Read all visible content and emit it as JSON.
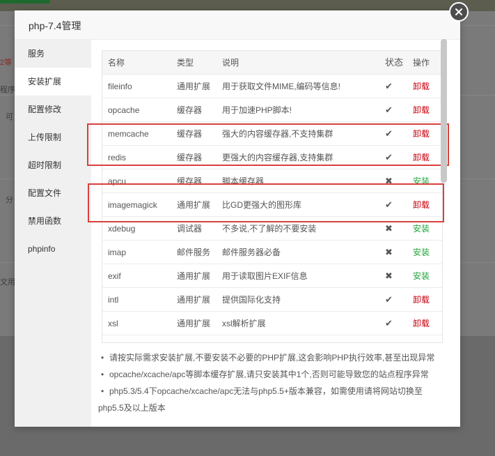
{
  "background": {
    "fragments": [
      "2等",
      "程序,",
      "可",
      "分",
      "文用户"
    ]
  },
  "modal": {
    "title": "php-7.4管理"
  },
  "sidebar": {
    "items": [
      {
        "label": "服务"
      },
      {
        "label": "安装扩展"
      },
      {
        "label": "配置修改"
      },
      {
        "label": "上传限制"
      },
      {
        "label": "超时限制"
      },
      {
        "label": "配置文件"
      },
      {
        "label": "禁用函数"
      },
      {
        "label": "phpinfo"
      }
    ],
    "active_index": 1
  },
  "table": {
    "headers": {
      "name": "名称",
      "type": "类型",
      "desc": "说明",
      "status": "状态",
      "action": "操作"
    },
    "rows": [
      {
        "name": "fileinfo",
        "type": "通用扩展",
        "desc": "用于获取文件MIME,编码等信息!",
        "status": "✔",
        "action": "卸载"
      },
      {
        "name": "opcache",
        "type": "缓存器",
        "desc": "用于加速PHP脚本!",
        "status": "✔",
        "action": "卸载"
      },
      {
        "name": "memcache",
        "type": "缓存器",
        "desc": "强大的内容缓存器,不支持集群",
        "status": "✔",
        "action": "卸载"
      },
      {
        "name": "redis",
        "type": "缓存器",
        "desc": "更强大的内容缓存器,支持集群",
        "status": "✔",
        "action": "卸载"
      },
      {
        "name": "apcu",
        "type": "缓存器",
        "desc": "脚本缓存器",
        "status": "✖",
        "action": "安装"
      },
      {
        "name": "imagemagick",
        "type": "通用扩展",
        "desc": "比GD更强大的图形库",
        "status": "✔",
        "action": "卸载"
      },
      {
        "name": "xdebug",
        "type": "调试器",
        "desc": "不多说,不了解的不要安装",
        "status": "✖",
        "action": "安装"
      },
      {
        "name": "imap",
        "type": "邮件服务",
        "desc": "邮件服务器必备",
        "status": "✖",
        "action": "安装"
      },
      {
        "name": "exif",
        "type": "通用扩展",
        "desc": "用于读取图片EXIF信息",
        "status": "✖",
        "action": "安装"
      },
      {
        "name": "intl",
        "type": "通用扩展",
        "desc": "提供国际化支持",
        "status": "✔",
        "action": "卸载"
      },
      {
        "name": "xsl",
        "type": "通用扩展",
        "desc": "xsl解析扩展",
        "status": "✔",
        "action": "卸载"
      }
    ]
  },
  "tips": [
    "请按实际需求安装扩展,不要安装不必要的PHP扩展,这会影响PHP执行效率,甚至出现异常",
    "opcache/xcache/apc等脚本缓存扩展,请只安装其中1个,否则可能导致您的站点程序异常",
    "php5.3/5.4下opcache/xcache/apc无法与php5.5+版本兼容，如需使用请将网站切换至",
    "php5.5及以上版本"
  ],
  "colors": {
    "uninstall": "#c7000b",
    "install": "#20a53a",
    "highlight": "#d9403c"
  },
  "icons": {
    "close": "close-icon",
    "installed": "check-icon",
    "not_installed": "cross-icon"
  }
}
